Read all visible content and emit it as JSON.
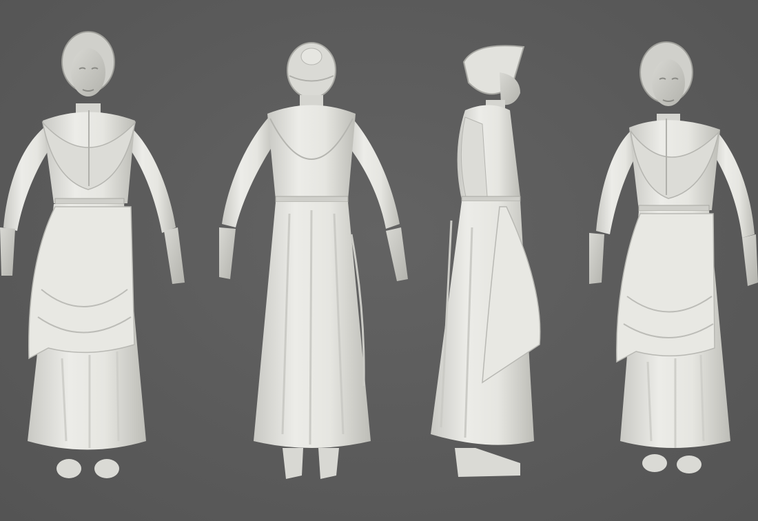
{
  "scene": {
    "background_color": "#5a5a5a",
    "material_color": "#e4e4e0",
    "shadow_color": "#b9b9b4",
    "views": [
      {
        "id": "front",
        "icon": "figure-front-view-icon"
      },
      {
        "id": "back",
        "icon": "figure-back-view-icon"
      },
      {
        "id": "side",
        "icon": "figure-side-view-icon"
      },
      {
        "id": "three-quarter",
        "icon": "figure-three-quarter-view-icon"
      }
    ]
  }
}
